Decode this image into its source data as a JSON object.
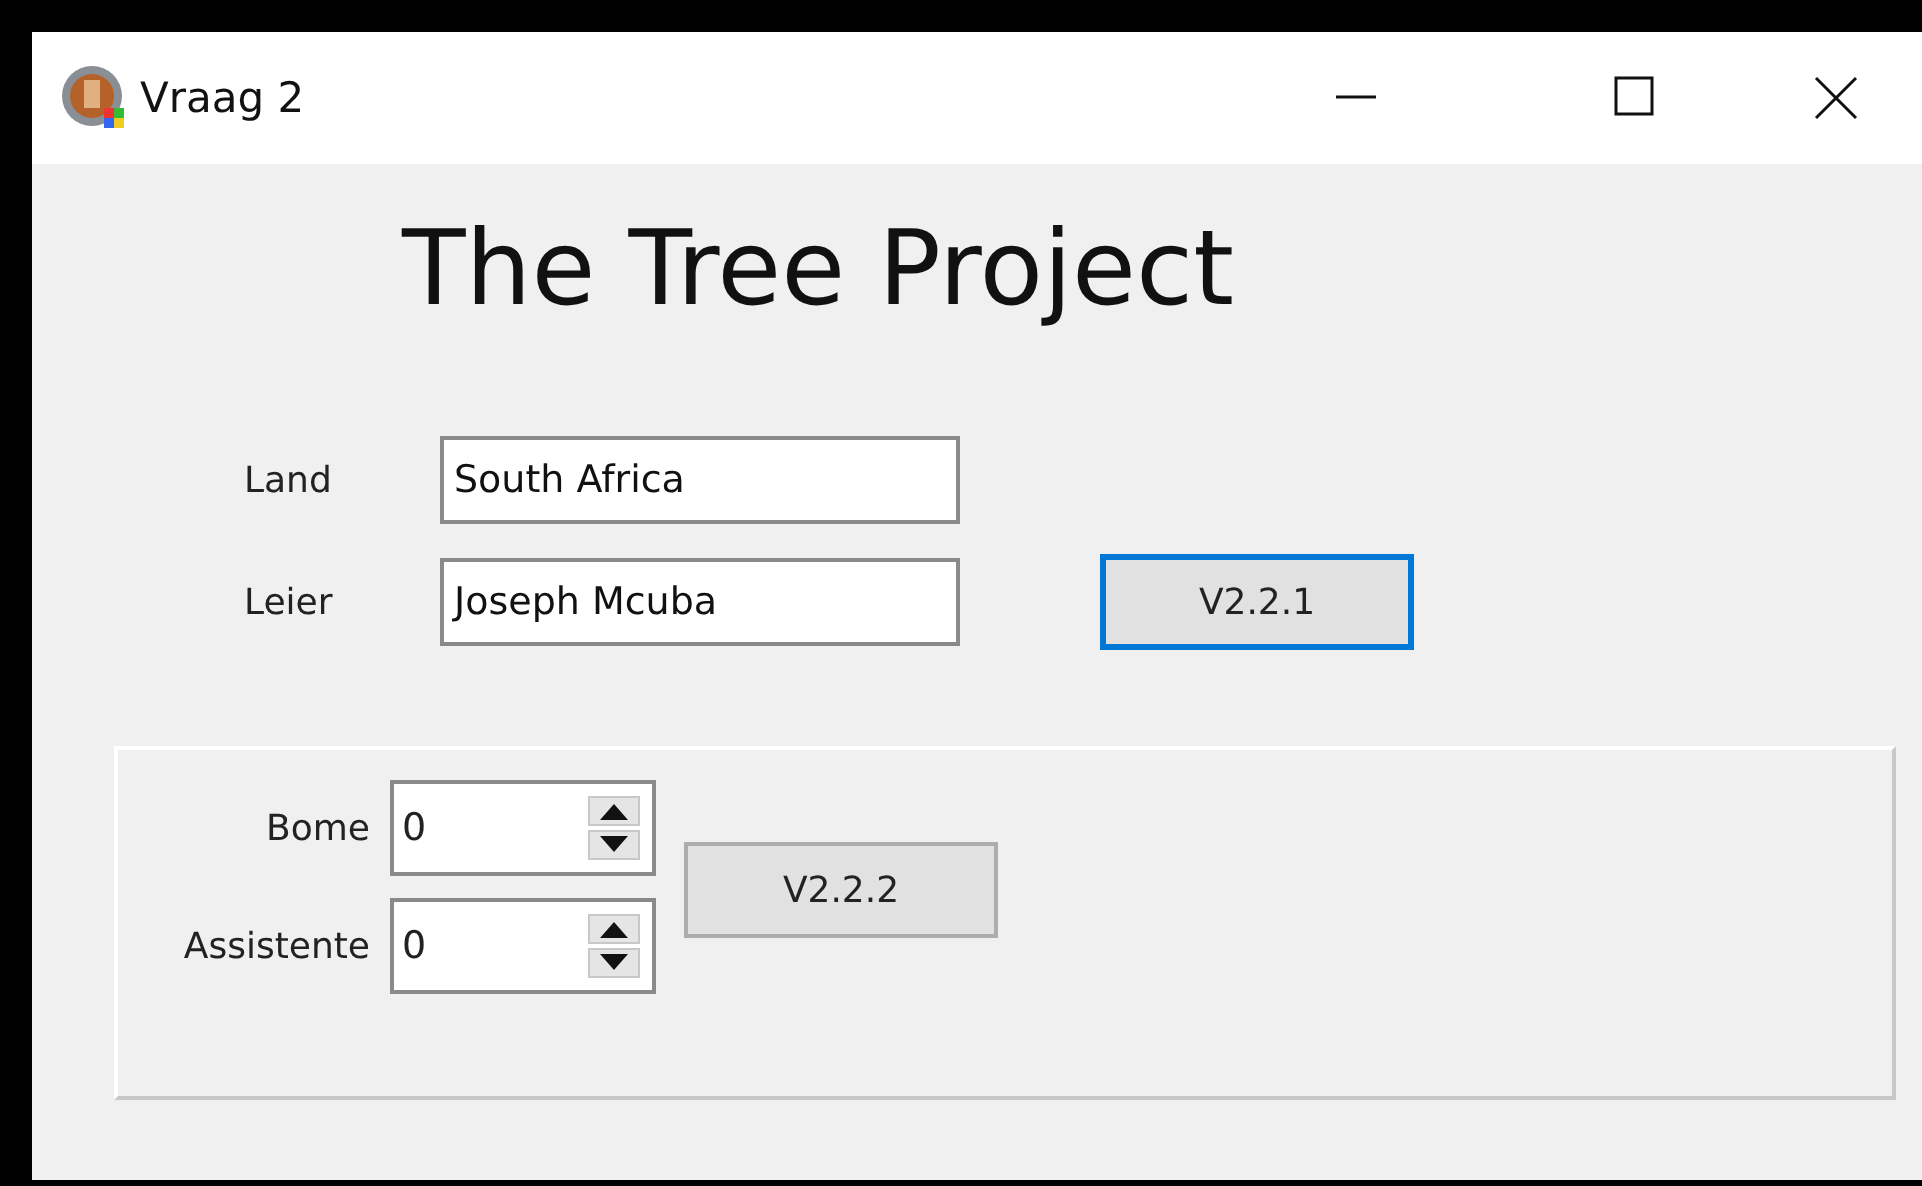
{
  "window": {
    "title": "Vraag 2"
  },
  "heading": "The Tree Project",
  "fields": [
    {
      "label": "Land",
      "value": "South Africa"
    },
    {
      "label": "Leier",
      "value": "Joseph Mcuba"
    }
  ],
  "button": {
    "label": "V2.2.1",
    "focused": true
  },
  "group": {
    "spinners": [
      {
        "label": "Bome",
        "value": "0"
      },
      {
        "label": "Assistente",
        "value": "0"
      }
    ],
    "button": {
      "label": "V2.2.2",
      "focused": false
    }
  }
}
